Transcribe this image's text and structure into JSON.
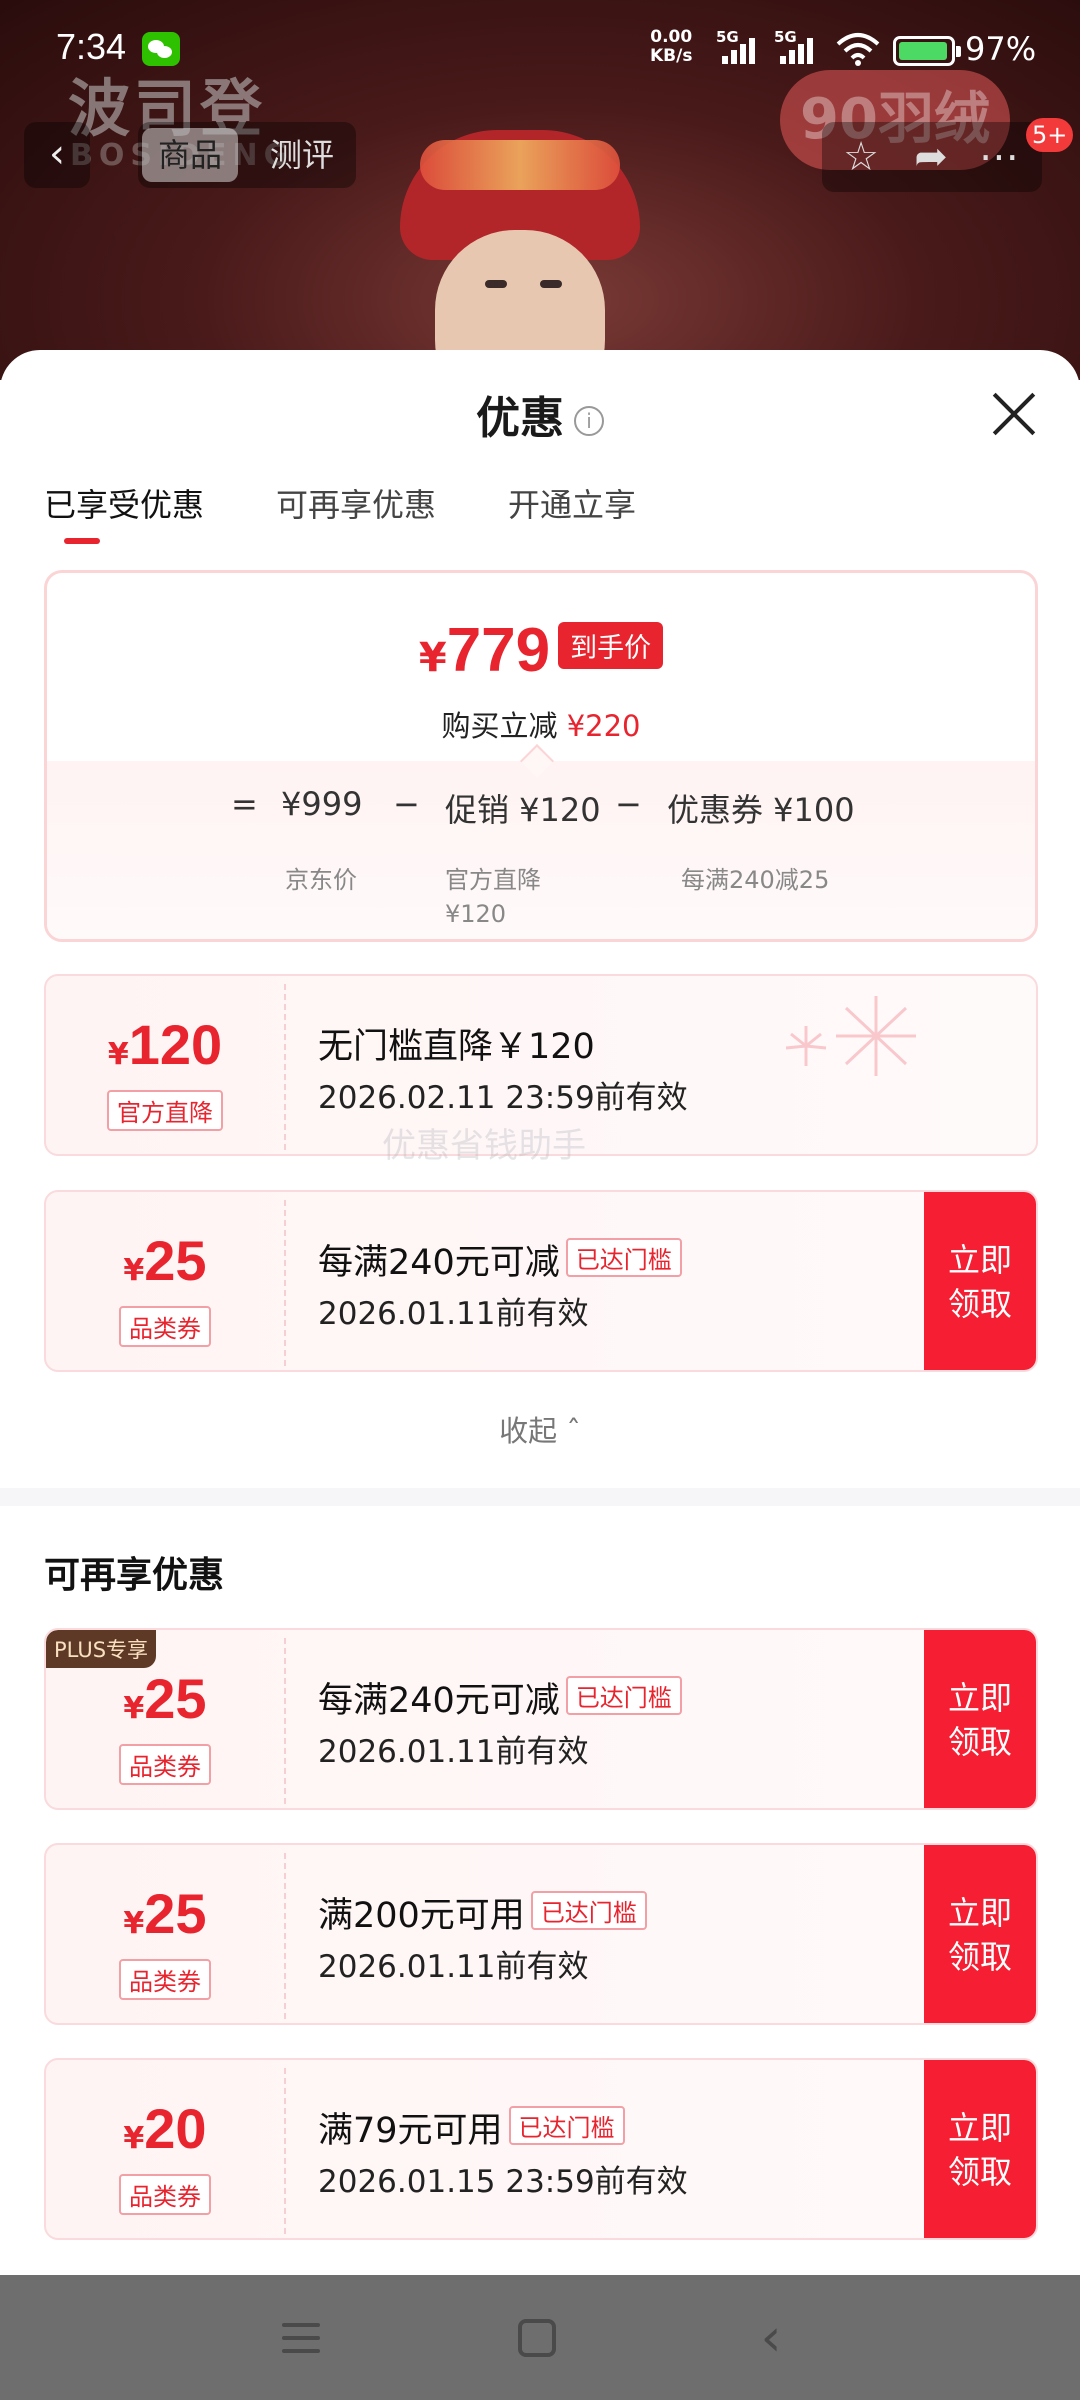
{
  "status_bar": {
    "time": "7:34",
    "net_speed_value": "0.00",
    "net_speed_unit": "KB/s",
    "signal_1": "5G",
    "signal_2": "5G",
    "battery": "97%"
  },
  "background": {
    "brand": "波司登",
    "brand_sub": "BOSIDENG",
    "badge": "90羽绒"
  },
  "page_nav": {
    "tab_product": "商品",
    "tab_review": "测评",
    "badge": "5+"
  },
  "sheet": {
    "title": "优惠",
    "tabs": [
      "已享受优惠",
      "可再享优惠",
      "开通立享"
    ],
    "summary": {
      "final_price_symbol": "¥",
      "final_price": "779",
      "final_price_tag": "到手价",
      "cut_label": "购买立减",
      "cut_amount": "¥220",
      "formula": {
        "equals": "=",
        "base": "¥999",
        "minus1": "−",
        "promo": "促销 ¥120",
        "minus2": "−",
        "coupon": "优惠券 ¥100",
        "base_label": "京东价",
        "promo_label": "官方直降",
        "promo_label_2": "¥120",
        "coupon_label": "每满240减25"
      }
    },
    "enjoyed": [
      {
        "symbol": "¥",
        "amount": "120",
        "type": "官方直降",
        "title": "无门槛直降￥120",
        "valid": "2026.02.11 23:59前有效"
      },
      {
        "symbol": "¥",
        "amount": "25",
        "type": "品类券",
        "title": "每满240元可减",
        "threshold": "已达门槛",
        "valid": "2026.01.11前有效",
        "claim": "立即领取"
      }
    ],
    "watermark": "优惠省钱助手",
    "collapse_label": "收起",
    "section_title": "可再享优惠",
    "more": [
      {
        "plus": "PLUS专享",
        "symbol": "¥",
        "amount": "25",
        "type": "品类券",
        "title": "每满240元可减",
        "threshold": "已达门槛",
        "valid": "2026.01.11前有效",
        "claim": "立即领取"
      },
      {
        "symbol": "¥",
        "amount": "25",
        "type": "品类券",
        "title": "满200元可用",
        "threshold": "已达门槛",
        "valid": "2026.01.11前有效",
        "claim": "立即领取"
      },
      {
        "symbol": "¥",
        "amount": "20",
        "type": "品类券",
        "title": "满79元可用",
        "threshold": "已达门槛",
        "valid": "2026.01.15 23:59前有效",
        "claim": "立即领取"
      }
    ]
  },
  "colors": {
    "accent": "#e8252f",
    "claim_button": "#f51e32",
    "plus_tag": "#5e3a26"
  }
}
